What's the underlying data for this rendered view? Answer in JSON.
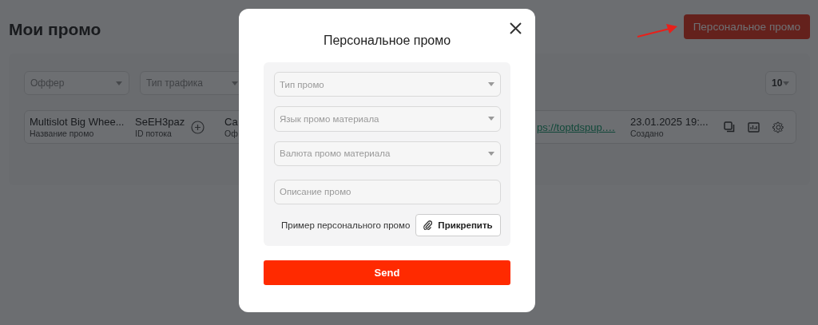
{
  "page": {
    "title": "Мои промо",
    "header_button": "Персональное промо",
    "filters": [
      {
        "placeholder": "Оффер"
      },
      {
        "placeholder": "Тип трафика"
      }
    ],
    "page_size": "10",
    "rows": [
      {
        "cells": [
          {
            "kind": "text",
            "value": "Multislot Big Whee...",
            "label": "Название промо"
          },
          {
            "kind": "id",
            "value": "SeEH3paz",
            "label": "ID потока"
          },
          {
            "kind": "text",
            "value": "Ca",
            "label": "Оф"
          },
          {
            "kind": "link",
            "value": "ps://toptdspup.…"
          },
          {
            "kind": "text",
            "value": "23.01.2025 19:...",
            "label": "Создано"
          }
        ]
      }
    ]
  },
  "modal": {
    "title": "Персональное промо",
    "fields": [
      {
        "kind": "select",
        "placeholder": "Тип промо"
      },
      {
        "kind": "select",
        "placeholder": "Язык промо материала"
      },
      {
        "kind": "select",
        "placeholder": "Валюта промо материала"
      },
      {
        "kind": "input",
        "placeholder": "Описание промо"
      }
    ],
    "attachment": {
      "label": "Пример персонального промо",
      "button": "Прикрепить"
    },
    "submit": "Send"
  }
}
